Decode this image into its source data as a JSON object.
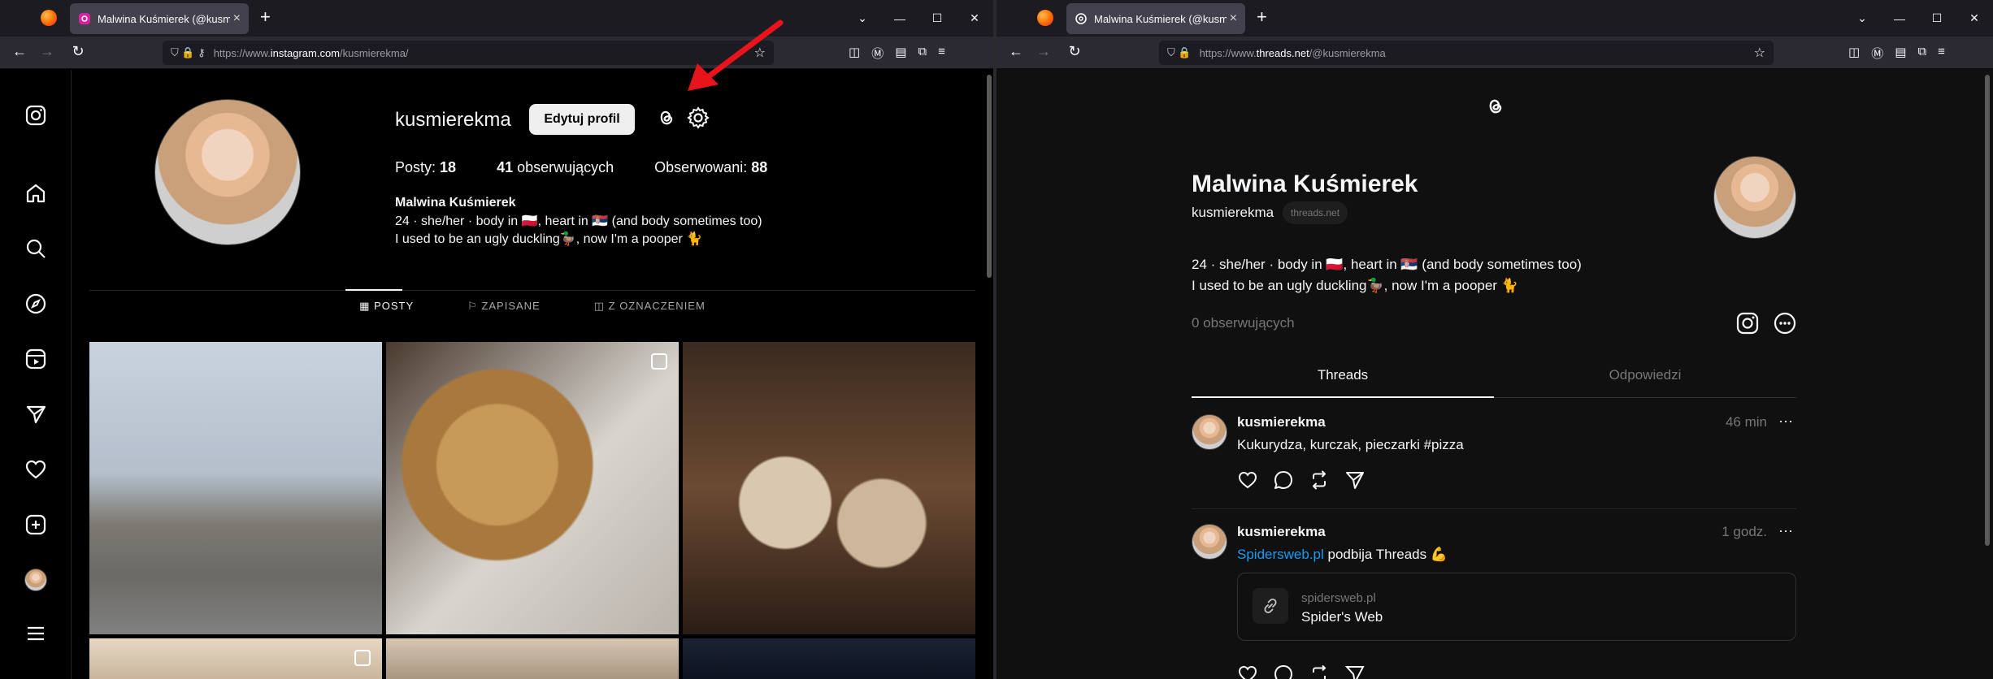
{
  "left": {
    "tab_title": "Malwina Kuśmierek (@kusmierekma)",
    "url_prefix": "https://www.",
    "url_domain": "instagram.com",
    "url_suffix": "/kusmierekma/",
    "profile": {
      "username": "kusmierekma",
      "edit_label": "Edytuj profil",
      "stats": [
        {
          "label": "Posty: ",
          "value": "18"
        },
        {
          "value": "41",
          "label": " obserwujących"
        },
        {
          "label": "Obserwowani: ",
          "value": "88"
        }
      ],
      "name": "Malwina Kuśmierek",
      "bio": "24 · she/her · body in 🇵🇱, heart in 🇷🇸 (and body sometimes too)\nI used to be an ugly duckling🦆, now I'm a pooper 🐈"
    },
    "tabs": [
      "POSTY",
      "ZAPISANE",
      "Z OZNACZENIEM"
    ],
    "sidebar": [
      "instagram-logo",
      "home",
      "search",
      "explore",
      "reels",
      "messages",
      "notifications",
      "create",
      "profile",
      "menu"
    ]
  },
  "right": {
    "tab_title": "Malwina Kuśmierek (@kusmierekma)",
    "url_prefix": "https://www.",
    "url_domain": "threads.net",
    "url_suffix": "/@kusmierekma",
    "profile": {
      "name": "Malwina Kuśmierek",
      "handle": "kusmierekma",
      "badge": "threads.net",
      "bio": "24 · she/her · body in 🇵🇱, heart in 🇷🇸 (and body sometimes too)\nI used to be an ugly duckling🦆, now I'm a pooper 🐈",
      "followers": "0 obserwujących"
    },
    "tabs": [
      "Threads",
      "Odpowiedzi"
    ],
    "posts": [
      {
        "user": "kusmierekma",
        "time": "46 min",
        "text": "Kukurydza, kurczak, pieczarki #pizza"
      },
      {
        "user": "kusmierekma",
        "time": "1 godz.",
        "link": "Spidersweb.pl",
        "text": " podbija Threads 💪",
        "card_domain": "spidersweb.pl",
        "card_title": "Spider's Web"
      }
    ]
  },
  "colors": {
    "accent": "#1d9bf0",
    "arrow": "#e8141b"
  }
}
